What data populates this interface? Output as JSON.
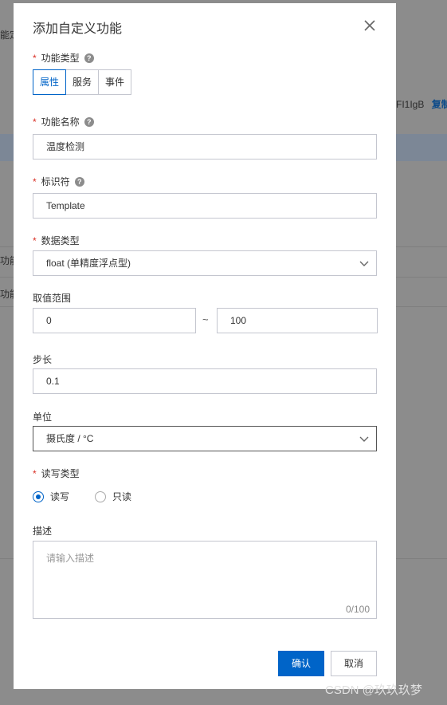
{
  "background": {
    "left_text_1": "能定",
    "right_text": "FI1IgB",
    "right_link": "复制",
    "left_text_2": "功能",
    "left_text_3": "功能"
  },
  "dialog": {
    "title": "添加自定义功能",
    "function_type": {
      "label": "功能类型",
      "options": [
        "属性",
        "服务",
        "事件"
      ],
      "selected": "属性"
    },
    "function_name": {
      "label": "功能名称",
      "value": "温度检测"
    },
    "identifier": {
      "label": "标识符",
      "value": "Template"
    },
    "data_type": {
      "label": "数据类型",
      "value": "float (单精度浮点型)"
    },
    "value_range": {
      "label": "取值范围",
      "min": "0",
      "separator": "~",
      "max": "100"
    },
    "step": {
      "label": "步长",
      "value": "0.1"
    },
    "unit": {
      "label": "单位",
      "value": "摄氏度 / °C"
    },
    "rw_type": {
      "label": "读写类型",
      "options": [
        "读写",
        "只读"
      ],
      "selected": "读写"
    },
    "description": {
      "label": "描述",
      "placeholder": "请输入描述",
      "counter": "0/100"
    },
    "confirm_label": "确认",
    "cancel_label": "取消"
  },
  "watermark": "CSDN @玖玖玖梦",
  "colors": {
    "primary": "#0064c8",
    "required": "#d93026"
  }
}
